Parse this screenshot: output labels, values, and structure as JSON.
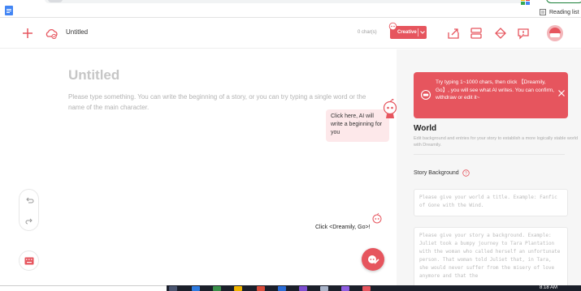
{
  "browser": {
    "reading_list": "Reading list"
  },
  "toolbar": {
    "doc_title": "Untitled",
    "char_count": "0 char(s)",
    "mode_label": "Creative"
  },
  "editor": {
    "title_placeholder": "Untitled",
    "body_placeholder": "Please type something. You can write the beginning of a story, or you can try typing a single word or the name of the main character.",
    "ai_bubble": "Click here, AI will write a beginning for you",
    "go_hint": "Click <Dreamily, Go>!"
  },
  "panel": {
    "tip": "Try typing 1~1000 chars, then click 【Dreamily, Go】, you will see what AI writes. You can confirm, withdraw or edit it~",
    "world_heading": "World",
    "world_desc": "Edit background and entries for your story to establish a more logically stable world with Dreamily.",
    "story_bg_label": "Story Background",
    "world_title_placeholder": "Please give your world a title. Example: Fanfic of Gone with the Wind.",
    "story_bg_placeholder": "Please give your story a background. Example: Juliet took a bumpy journey to Tara Plantation with the woman who called herself an unfortunate person. That woman told Juliet that, in Tara, she would never suffer from the misery of love anymore and that the"
  },
  "taskbar": {
    "clock": "8:18 AM"
  },
  "colors": {
    "accent": "#e6555e",
    "panel_bg": "#f6f6f6",
    "tip_bg": "#e6555e"
  }
}
